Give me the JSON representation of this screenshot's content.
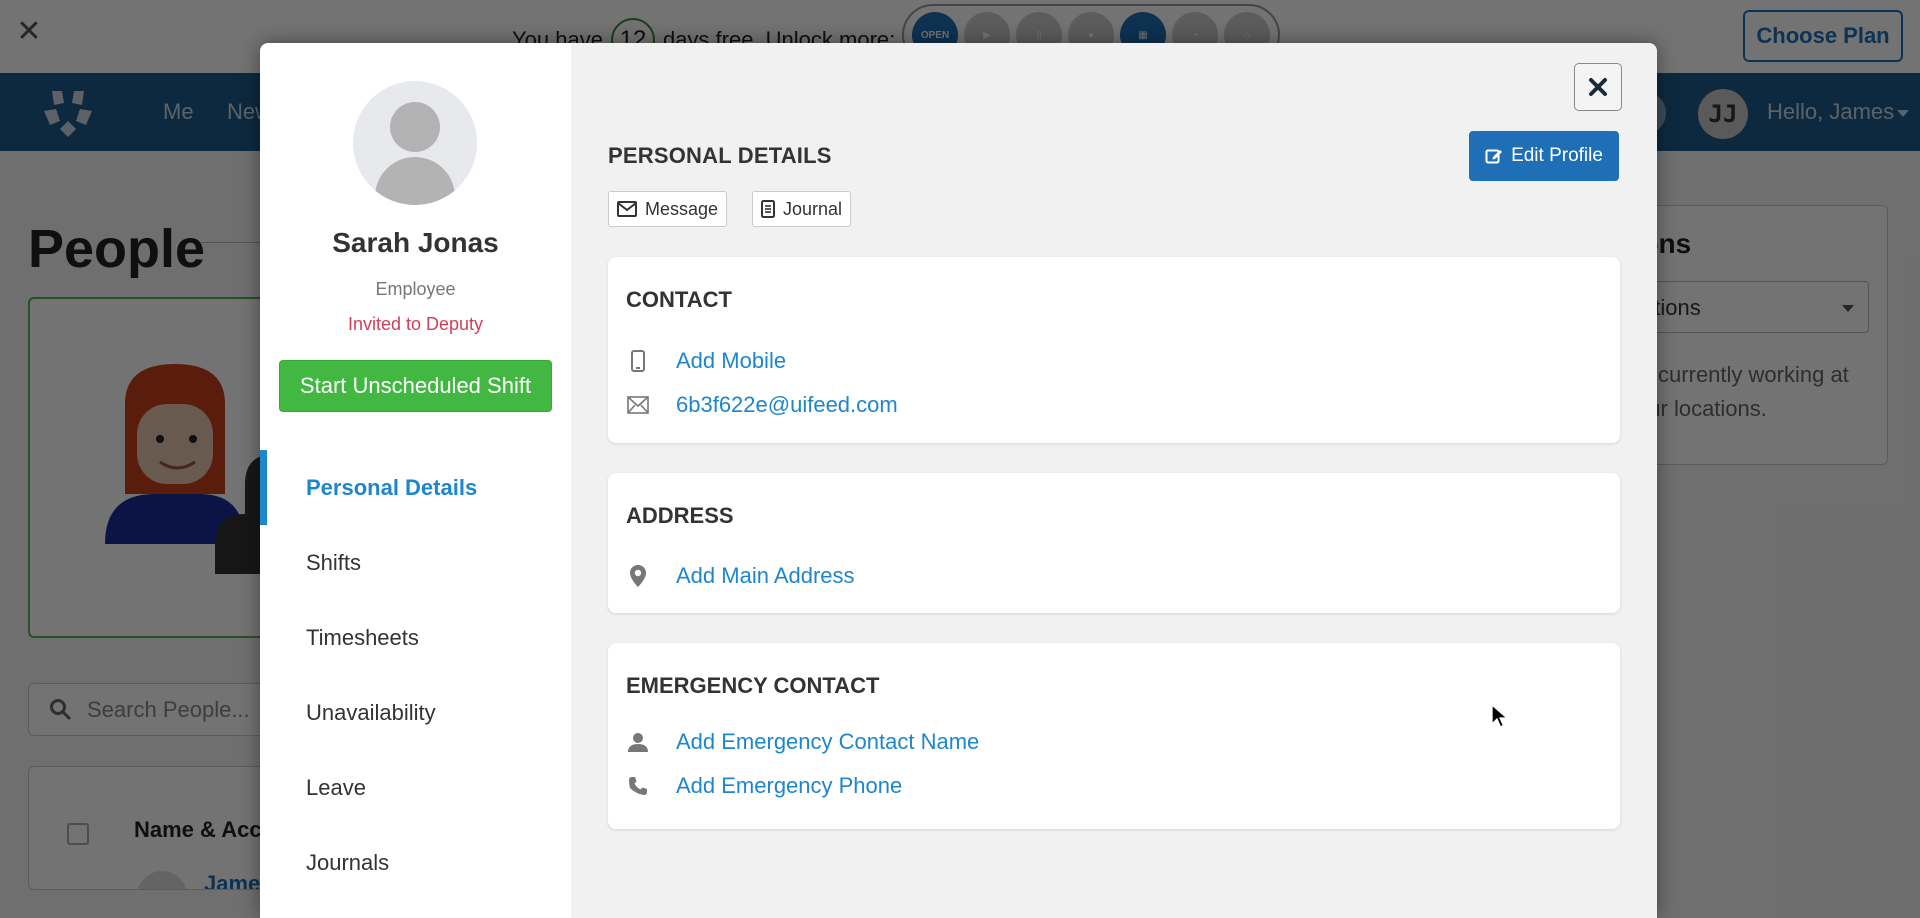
{
  "trial_banner": {
    "prefix": "You have",
    "days": "12",
    "suffix": "days free. Unlock more:",
    "features": [
      {
        "name": "open-shifts-icon",
        "label": "OPEN",
        "active": true
      },
      {
        "name": "video-icon",
        "label": "",
        "active": false
      },
      {
        "name": "mobile-app-icon",
        "label": "",
        "active": false
      },
      {
        "name": "person-icon",
        "label": "",
        "active": false
      },
      {
        "name": "calendar-icon",
        "label": "",
        "active": true
      },
      {
        "name": "stopwatch-icon",
        "label": "",
        "active": false
      },
      {
        "name": "store-icon",
        "label": "",
        "active": false
      }
    ],
    "choose_plan": "Choose Plan"
  },
  "nav": {
    "items": [
      "Me",
      "New"
    ],
    "avatar_initials": "JJ",
    "greeting": "Hello, James"
  },
  "background_page": {
    "title": "People",
    "search_placeholder": "Search People...",
    "table_header": "Name & Access",
    "first_row_name": "James",
    "locations_title": "Locations",
    "locations_select": "All Locations",
    "locations_message": "No one is currently working at any of your locations."
  },
  "modal": {
    "profile": {
      "name": "Sarah Jonas",
      "role": "Employee",
      "status": "Invited to Deputy",
      "start_shift": "Start Unscheduled Shift"
    },
    "side_nav": [
      {
        "label": "Personal Details",
        "active": true
      },
      {
        "label": "Shifts",
        "active": false
      },
      {
        "label": "Timesheets",
        "active": false
      },
      {
        "label": "Unavailability",
        "active": false
      },
      {
        "label": "Leave",
        "active": false
      },
      {
        "label": "Journals",
        "active": false
      }
    ],
    "section_title": "PERSONAL DETAILS",
    "edit_profile": "Edit Profile",
    "message_btn": "Message",
    "journal_btn": "Journal",
    "contact": {
      "title": "CONTACT",
      "mobile": "Add Mobile",
      "email": "6b3f622e@uifeed.com"
    },
    "address": {
      "title": "ADDRESS",
      "main": "Add Main Address"
    },
    "emergency": {
      "title": "EMERGENCY CONTACT",
      "name": "Add Emergency Contact Name",
      "phone": "Add Emergency Phone"
    }
  },
  "colors": {
    "primary": "#1e6fb5",
    "link": "#1e86cc",
    "success": "#42b842",
    "status_invited": "#d0405a",
    "nav_bg": "#1d5c8c"
  }
}
